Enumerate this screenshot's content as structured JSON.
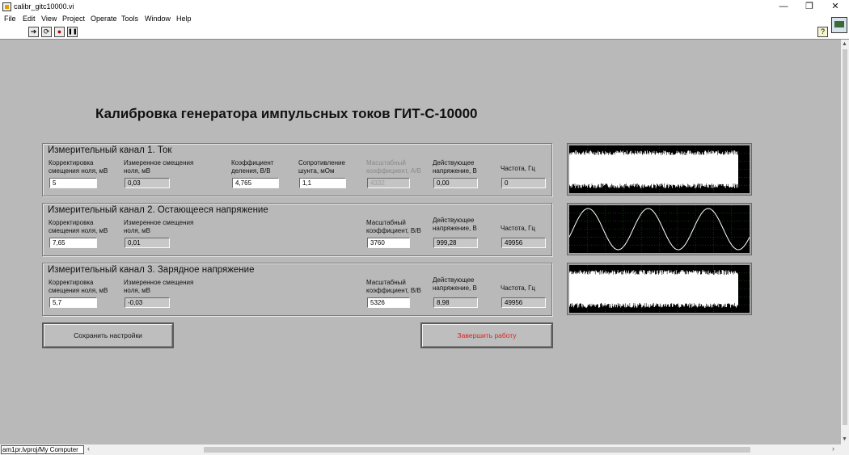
{
  "window": {
    "title": "calibr_gitc10000.vi",
    "minimize": "—",
    "maximize": "❐",
    "close": "✕"
  },
  "menu": [
    "File",
    "Edit",
    "View",
    "Project",
    "Operate",
    "Tools",
    "Window",
    "Help"
  ],
  "toolbar": {
    "run": "➔",
    "run_continuous": "⟳",
    "abort": "●",
    "pause": "❚❚",
    "help": "?"
  },
  "heading": "Калибровка генератора импульсных токов ГИТ-С-10000",
  "channels": [
    {
      "title": "Измерительный канал 1. Ток",
      "offset_corr_label": "Корректировка смещения ноля, мВ",
      "offset_corr_value": "5",
      "offset_meas_label": "Измеренное смещения ноля, мВ",
      "offset_meas_value": "0,03",
      "divider_label": "Коэффициент деления, В/В",
      "divider_value": "4,765",
      "shunt_label": "Сопротивление шунта, мОм",
      "shunt_value": "1,1",
      "scale_label": "Масштабный коэффициент, А/В",
      "scale_value": "4332",
      "rms_label": "Действующее напряжение, В",
      "rms_value": "0,00",
      "freq_label": "Частота, Гц",
      "freq_value": "0"
    },
    {
      "title": "Измерительный канал 2. Остающееся напряжение",
      "offset_corr_label": "Корректировка смещения ноля, мВ",
      "offset_corr_value": "7,65",
      "offset_meas_label": "Измеренное смещения ноля, мВ",
      "offset_meas_value": "0,01",
      "scale_label": "Масштабный коэффициент, В/В",
      "scale_value": "3760",
      "rms_label": "Действующее напряжение, В",
      "rms_value": "999,28",
      "freq_label": "Частота, Гц",
      "freq_value": "49956"
    },
    {
      "title": "Измерительный канал 3. Зарядное напряжение",
      "offset_corr_label": "Корректировка смещения ноля, мВ",
      "offset_corr_value": "5,7",
      "offset_meas_label": "Измеренное смещения ноля, мВ",
      "offset_meas_value": "-0,03",
      "scale_label": "Масштабный коэффициент, В/В",
      "scale_value": "5326",
      "rms_label": "Действующее напряжение, В",
      "rms_value": "8,98",
      "freq_label": "Частота, Гц",
      "freq_value": "49956"
    }
  ],
  "graphs": [
    {
      "signal": "noise",
      "trace_color": "#ffffff",
      "grid_color": "#1e5a1e"
    },
    {
      "signal": "sine",
      "cycles": 3,
      "trace_color": "#ffffff",
      "grid_color": "#1e5a1e"
    },
    {
      "signal": "noise",
      "trace_color": "#ffffff",
      "grid_color": "#1e5a1e"
    }
  ],
  "buttons": {
    "save": "Сохранить настройки",
    "stop": "Завершить работу"
  },
  "status": {
    "project_path": "am1pr.lvproj/My Computer"
  },
  "colors": {
    "panel": "#b9b9b9",
    "stop_text": "#e02020",
    "graph_bg": "#000000"
  }
}
